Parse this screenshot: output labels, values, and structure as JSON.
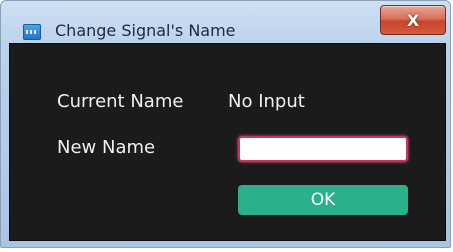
{
  "window": {
    "title": "Change Signal's Name",
    "close_glyph": "X",
    "app_icon": "signal-app-icon"
  },
  "form": {
    "current_name_label": "Current Name",
    "current_name_value": "No Input",
    "new_name_label": "New Name",
    "new_name_value": "",
    "ok_label": "OK"
  },
  "colors": {
    "content_background": "#1b1b1b",
    "ok_button": "#2bb08c",
    "input_focus_border": "#c9355b",
    "close_button": "#c8452d"
  }
}
